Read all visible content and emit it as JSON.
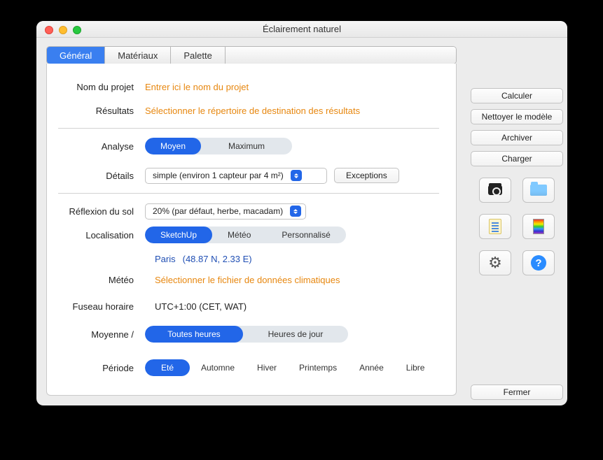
{
  "window": {
    "title": "Éclairement naturel"
  },
  "tabs": {
    "general": "Général",
    "materials": "Matériaux",
    "palette": "Palette"
  },
  "labels": {
    "project_name": "Nom du projet",
    "results": "Résultats",
    "analysis": "Analyse",
    "details": "Détails",
    "ground_reflection": "Réflexion du sol",
    "location": "Localisation",
    "weather": "Météo",
    "timezone": "Fuseau horaire",
    "average": "Moyenne /",
    "period": "Période"
  },
  "placeholders": {
    "project_name": "Entrer ici le nom du projet",
    "results": "Sélectionner le répertoire de destination des résultats",
    "weather": "Sélectionner le fichier de données climatiques"
  },
  "analysis": {
    "moyen": "Moyen",
    "maximum": "Maximum"
  },
  "details": {
    "select_value": "simple (environ 1 capteur par 4 m²)",
    "exceptions_btn": "Exceptions"
  },
  "ground_reflection": {
    "select_value": "20% (par défaut, herbe, macadam)"
  },
  "location": {
    "sketchup": "SketchUp",
    "meteo": "Météo",
    "custom": "Personnalisé",
    "city": "Paris",
    "coords": "(48.87 N, 2.33 E)"
  },
  "timezone": {
    "value": "UTC+1:00 (CET, WAT)"
  },
  "average": {
    "all_hours": "Toutes heures",
    "day_hours": "Heures de jour"
  },
  "period": {
    "ete": "Eté",
    "automne": "Automne",
    "hiver": "Hiver",
    "printemps": "Printemps",
    "annee": "Année",
    "libre": "Libre"
  },
  "sidebar": {
    "calculate": "Calculer",
    "clean_model": "Nettoyer le modèle",
    "archive": "Archiver",
    "load": "Charger",
    "close": "Fermer"
  }
}
